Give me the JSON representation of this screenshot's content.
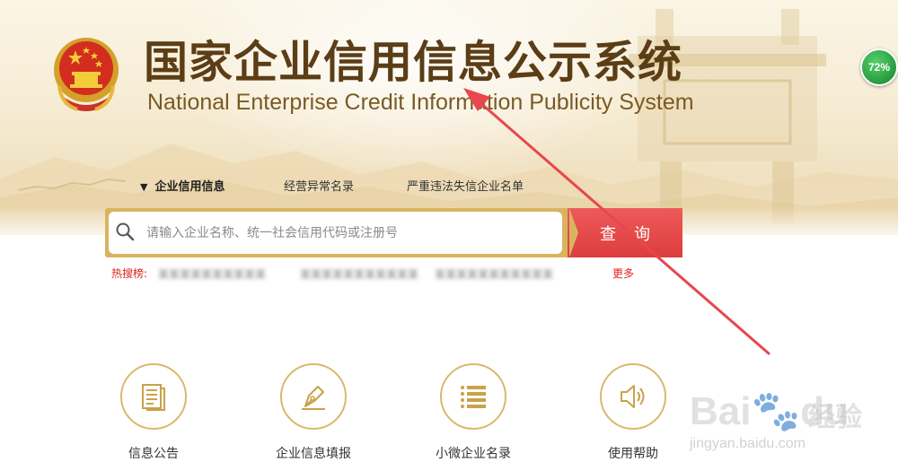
{
  "header": {
    "title_cn": "国家企业信用信息公示系统",
    "title_en": "National Enterprise Credit Information Publicity System",
    "emblem_icon": "national-emblem-icon"
  },
  "badge": {
    "text": "72%",
    "color": "#2ea245"
  },
  "tabs": [
    {
      "label": "企业信用信息",
      "active": true,
      "arrow": "▼"
    },
    {
      "label": "经营异常名录",
      "active": false
    },
    {
      "label": "严重违法失信企业名单",
      "active": false
    }
  ],
  "search": {
    "placeholder": "请输入企业名称、统一社会信用代码或注册号",
    "value": "",
    "button_label": "查询",
    "icon": "search-icon"
  },
  "hot_search": {
    "label": "热搜榜:",
    "items": [
      "某某某某某某某某某某",
      "某某某某某某某某某某某",
      "某某某某某某某某某某某"
    ],
    "more_label": "更多"
  },
  "features": [
    {
      "label": "信息公告",
      "icon": "document-icon"
    },
    {
      "label": "企业信息填报",
      "icon": "pen-icon"
    },
    {
      "label": "小微企业名录",
      "icon": "list-icon"
    },
    {
      "label": "使用帮助",
      "icon": "speaker-icon"
    }
  ],
  "watermark": {
    "brand": "Bai",
    "brand2": "du",
    "cn": "经验",
    "url": "jingyan.baidu.com"
  },
  "colors": {
    "accent_gold": "#d9b45f",
    "button_red": "#dd3d3d",
    "title_brown": "#5b3d16",
    "hot_red": "#e02020",
    "annotation_red": "#e8474d"
  }
}
